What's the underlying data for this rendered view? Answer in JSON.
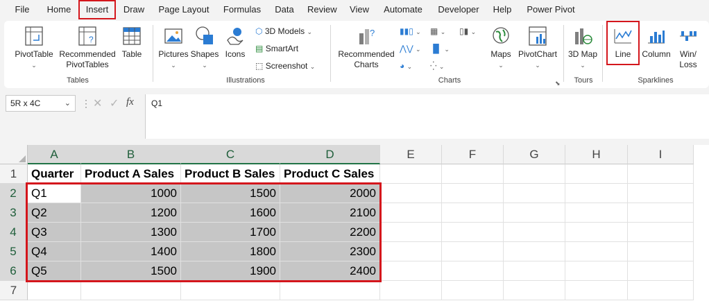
{
  "menu": {
    "tabs": [
      "File",
      "Home",
      "Insert",
      "Draw",
      "Page Layout",
      "Formulas",
      "Data",
      "Review",
      "View",
      "Automate",
      "Developer",
      "Help",
      "Power Pivot"
    ],
    "active": "Insert"
  },
  "ribbon": {
    "tables": {
      "group": "Tables",
      "pivottable": "PivotTable",
      "recommended": "Recommended PivotTables",
      "table": "Table"
    },
    "illustrations": {
      "group": "Illustrations",
      "pictures": "Pictures",
      "shapes": "Shapes",
      "icons": "Icons",
      "models3d": "3D Models",
      "smartart": "SmartArt",
      "screenshot": "Screenshot"
    },
    "charts": {
      "group": "Charts",
      "recommended": "Recommended Charts",
      "maps": "Maps",
      "pivotchart": "PivotChart"
    },
    "tours": {
      "group": "Tours",
      "map3d": "3D Map"
    },
    "sparklines": {
      "group": "Sparklines",
      "line": "Line",
      "column": "Column",
      "winloss": "Win/ Loss"
    }
  },
  "formula": {
    "namebox": "5R x 4C",
    "value": "Q1"
  },
  "sheet": {
    "columns": [
      "A",
      "B",
      "C",
      "D",
      "E",
      "F",
      "G",
      "H",
      "I"
    ],
    "rows": [
      "1",
      "2",
      "3",
      "4",
      "5",
      "6",
      "7"
    ],
    "headers": [
      "Quarter",
      "Product A Sales",
      "Product B Sales",
      "Product C Sales"
    ],
    "data": [
      [
        "Q1",
        "1000",
        "1500",
        "2000"
      ],
      [
        "Q2",
        "1200",
        "1600",
        "2100"
      ],
      [
        "Q3",
        "1300",
        "1700",
        "2200"
      ],
      [
        "Q4",
        "1400",
        "1800",
        "2300"
      ],
      [
        "Q5",
        "1500",
        "1900",
        "2400"
      ]
    ]
  },
  "colors": {
    "accent": "#217346",
    "highlight": "#d4161c",
    "selection": "#c6c6c6"
  }
}
